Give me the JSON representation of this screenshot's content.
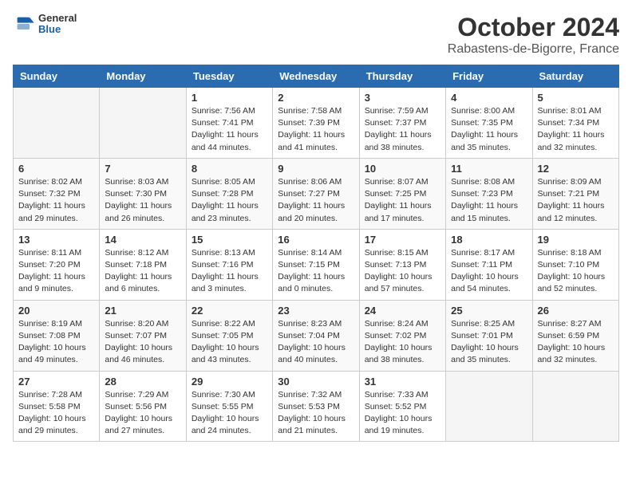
{
  "logo": {
    "general": "General",
    "blue": "Blue"
  },
  "header": {
    "title": "October 2024",
    "subtitle": "Rabastens-de-Bigorre, France"
  },
  "days_of_week": [
    "Sunday",
    "Monday",
    "Tuesday",
    "Wednesday",
    "Thursday",
    "Friday",
    "Saturday"
  ],
  "weeks": [
    [
      {
        "day": "",
        "detail": ""
      },
      {
        "day": "",
        "detail": ""
      },
      {
        "day": "1",
        "detail": "Sunrise: 7:56 AM\nSunset: 7:41 PM\nDaylight: 11 hours and 44 minutes."
      },
      {
        "day": "2",
        "detail": "Sunrise: 7:58 AM\nSunset: 7:39 PM\nDaylight: 11 hours and 41 minutes."
      },
      {
        "day": "3",
        "detail": "Sunrise: 7:59 AM\nSunset: 7:37 PM\nDaylight: 11 hours and 38 minutes."
      },
      {
        "day": "4",
        "detail": "Sunrise: 8:00 AM\nSunset: 7:35 PM\nDaylight: 11 hours and 35 minutes."
      },
      {
        "day": "5",
        "detail": "Sunrise: 8:01 AM\nSunset: 7:34 PM\nDaylight: 11 hours and 32 minutes."
      }
    ],
    [
      {
        "day": "6",
        "detail": "Sunrise: 8:02 AM\nSunset: 7:32 PM\nDaylight: 11 hours and 29 minutes."
      },
      {
        "day": "7",
        "detail": "Sunrise: 8:03 AM\nSunset: 7:30 PM\nDaylight: 11 hours and 26 minutes."
      },
      {
        "day": "8",
        "detail": "Sunrise: 8:05 AM\nSunset: 7:28 PM\nDaylight: 11 hours and 23 minutes."
      },
      {
        "day": "9",
        "detail": "Sunrise: 8:06 AM\nSunset: 7:27 PM\nDaylight: 11 hours and 20 minutes."
      },
      {
        "day": "10",
        "detail": "Sunrise: 8:07 AM\nSunset: 7:25 PM\nDaylight: 11 hours and 17 minutes."
      },
      {
        "day": "11",
        "detail": "Sunrise: 8:08 AM\nSunset: 7:23 PM\nDaylight: 11 hours and 15 minutes."
      },
      {
        "day": "12",
        "detail": "Sunrise: 8:09 AM\nSunset: 7:21 PM\nDaylight: 11 hours and 12 minutes."
      }
    ],
    [
      {
        "day": "13",
        "detail": "Sunrise: 8:11 AM\nSunset: 7:20 PM\nDaylight: 11 hours and 9 minutes."
      },
      {
        "day": "14",
        "detail": "Sunrise: 8:12 AM\nSunset: 7:18 PM\nDaylight: 11 hours and 6 minutes."
      },
      {
        "day": "15",
        "detail": "Sunrise: 8:13 AM\nSunset: 7:16 PM\nDaylight: 11 hours and 3 minutes."
      },
      {
        "day": "16",
        "detail": "Sunrise: 8:14 AM\nSunset: 7:15 PM\nDaylight: 11 hours and 0 minutes."
      },
      {
        "day": "17",
        "detail": "Sunrise: 8:15 AM\nSunset: 7:13 PM\nDaylight: 10 hours and 57 minutes."
      },
      {
        "day": "18",
        "detail": "Sunrise: 8:17 AM\nSunset: 7:11 PM\nDaylight: 10 hours and 54 minutes."
      },
      {
        "day": "19",
        "detail": "Sunrise: 8:18 AM\nSunset: 7:10 PM\nDaylight: 10 hours and 52 minutes."
      }
    ],
    [
      {
        "day": "20",
        "detail": "Sunrise: 8:19 AM\nSunset: 7:08 PM\nDaylight: 10 hours and 49 minutes."
      },
      {
        "day": "21",
        "detail": "Sunrise: 8:20 AM\nSunset: 7:07 PM\nDaylight: 10 hours and 46 minutes."
      },
      {
        "day": "22",
        "detail": "Sunrise: 8:22 AM\nSunset: 7:05 PM\nDaylight: 10 hours and 43 minutes."
      },
      {
        "day": "23",
        "detail": "Sunrise: 8:23 AM\nSunset: 7:04 PM\nDaylight: 10 hours and 40 minutes."
      },
      {
        "day": "24",
        "detail": "Sunrise: 8:24 AM\nSunset: 7:02 PM\nDaylight: 10 hours and 38 minutes."
      },
      {
        "day": "25",
        "detail": "Sunrise: 8:25 AM\nSunset: 7:01 PM\nDaylight: 10 hours and 35 minutes."
      },
      {
        "day": "26",
        "detail": "Sunrise: 8:27 AM\nSunset: 6:59 PM\nDaylight: 10 hours and 32 minutes."
      }
    ],
    [
      {
        "day": "27",
        "detail": "Sunrise: 7:28 AM\nSunset: 5:58 PM\nDaylight: 10 hours and 29 minutes."
      },
      {
        "day": "28",
        "detail": "Sunrise: 7:29 AM\nSunset: 5:56 PM\nDaylight: 10 hours and 27 minutes."
      },
      {
        "day": "29",
        "detail": "Sunrise: 7:30 AM\nSunset: 5:55 PM\nDaylight: 10 hours and 24 minutes."
      },
      {
        "day": "30",
        "detail": "Sunrise: 7:32 AM\nSunset: 5:53 PM\nDaylight: 10 hours and 21 minutes."
      },
      {
        "day": "31",
        "detail": "Sunrise: 7:33 AM\nSunset: 5:52 PM\nDaylight: 10 hours and 19 minutes."
      },
      {
        "day": "",
        "detail": ""
      },
      {
        "day": "",
        "detail": ""
      }
    ]
  ]
}
